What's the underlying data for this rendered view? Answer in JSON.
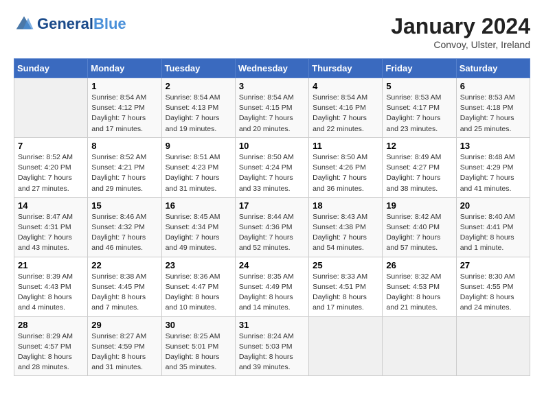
{
  "header": {
    "logo_text_general": "General",
    "logo_text_blue": "Blue",
    "title": "January 2024",
    "subtitle": "Convoy, Ulster, Ireland"
  },
  "days_of_week": [
    "Sunday",
    "Monday",
    "Tuesday",
    "Wednesday",
    "Thursday",
    "Friday",
    "Saturday"
  ],
  "weeks": [
    [
      {
        "num": "",
        "sunrise": "",
        "sunset": "",
        "daylight": ""
      },
      {
        "num": "1",
        "sunrise": "8:54 AM",
        "sunset": "4:12 PM",
        "daylight": "7 hours and 17 minutes."
      },
      {
        "num": "2",
        "sunrise": "8:54 AM",
        "sunset": "4:13 PM",
        "daylight": "7 hours and 19 minutes."
      },
      {
        "num": "3",
        "sunrise": "8:54 AM",
        "sunset": "4:15 PM",
        "daylight": "7 hours and 20 minutes."
      },
      {
        "num": "4",
        "sunrise": "8:54 AM",
        "sunset": "4:16 PM",
        "daylight": "7 hours and 22 minutes."
      },
      {
        "num": "5",
        "sunrise": "8:53 AM",
        "sunset": "4:17 PM",
        "daylight": "7 hours and 23 minutes."
      },
      {
        "num": "6",
        "sunrise": "8:53 AM",
        "sunset": "4:18 PM",
        "daylight": "7 hours and 25 minutes."
      }
    ],
    [
      {
        "num": "7",
        "sunrise": "8:52 AM",
        "sunset": "4:20 PM",
        "daylight": "7 hours and 27 minutes."
      },
      {
        "num": "8",
        "sunrise": "8:52 AM",
        "sunset": "4:21 PM",
        "daylight": "7 hours and 29 minutes."
      },
      {
        "num": "9",
        "sunrise": "8:51 AM",
        "sunset": "4:23 PM",
        "daylight": "7 hours and 31 minutes."
      },
      {
        "num": "10",
        "sunrise": "8:50 AM",
        "sunset": "4:24 PM",
        "daylight": "7 hours and 33 minutes."
      },
      {
        "num": "11",
        "sunrise": "8:50 AM",
        "sunset": "4:26 PM",
        "daylight": "7 hours and 36 minutes."
      },
      {
        "num": "12",
        "sunrise": "8:49 AM",
        "sunset": "4:27 PM",
        "daylight": "7 hours and 38 minutes."
      },
      {
        "num": "13",
        "sunrise": "8:48 AM",
        "sunset": "4:29 PM",
        "daylight": "7 hours and 41 minutes."
      }
    ],
    [
      {
        "num": "14",
        "sunrise": "8:47 AM",
        "sunset": "4:31 PM",
        "daylight": "7 hours and 43 minutes."
      },
      {
        "num": "15",
        "sunrise": "8:46 AM",
        "sunset": "4:32 PM",
        "daylight": "7 hours and 46 minutes."
      },
      {
        "num": "16",
        "sunrise": "8:45 AM",
        "sunset": "4:34 PM",
        "daylight": "7 hours and 49 minutes."
      },
      {
        "num": "17",
        "sunrise": "8:44 AM",
        "sunset": "4:36 PM",
        "daylight": "7 hours and 52 minutes."
      },
      {
        "num": "18",
        "sunrise": "8:43 AM",
        "sunset": "4:38 PM",
        "daylight": "7 hours and 54 minutes."
      },
      {
        "num": "19",
        "sunrise": "8:42 AM",
        "sunset": "4:40 PM",
        "daylight": "7 hours and 57 minutes."
      },
      {
        "num": "20",
        "sunrise": "8:40 AM",
        "sunset": "4:41 PM",
        "daylight": "8 hours and 1 minute."
      }
    ],
    [
      {
        "num": "21",
        "sunrise": "8:39 AM",
        "sunset": "4:43 PM",
        "daylight": "8 hours and 4 minutes."
      },
      {
        "num": "22",
        "sunrise": "8:38 AM",
        "sunset": "4:45 PM",
        "daylight": "8 hours and 7 minutes."
      },
      {
        "num": "23",
        "sunrise": "8:36 AM",
        "sunset": "4:47 PM",
        "daylight": "8 hours and 10 minutes."
      },
      {
        "num": "24",
        "sunrise": "8:35 AM",
        "sunset": "4:49 PM",
        "daylight": "8 hours and 14 minutes."
      },
      {
        "num": "25",
        "sunrise": "8:33 AM",
        "sunset": "4:51 PM",
        "daylight": "8 hours and 17 minutes."
      },
      {
        "num": "26",
        "sunrise": "8:32 AM",
        "sunset": "4:53 PM",
        "daylight": "8 hours and 21 minutes."
      },
      {
        "num": "27",
        "sunrise": "8:30 AM",
        "sunset": "4:55 PM",
        "daylight": "8 hours and 24 minutes."
      }
    ],
    [
      {
        "num": "28",
        "sunrise": "8:29 AM",
        "sunset": "4:57 PM",
        "daylight": "8 hours and 28 minutes."
      },
      {
        "num": "29",
        "sunrise": "8:27 AM",
        "sunset": "4:59 PM",
        "daylight": "8 hours and 31 minutes."
      },
      {
        "num": "30",
        "sunrise": "8:25 AM",
        "sunset": "5:01 PM",
        "daylight": "8 hours and 35 minutes."
      },
      {
        "num": "31",
        "sunrise": "8:24 AM",
        "sunset": "5:03 PM",
        "daylight": "8 hours and 39 minutes."
      },
      {
        "num": "",
        "sunrise": "",
        "sunset": "",
        "daylight": ""
      },
      {
        "num": "",
        "sunrise": "",
        "sunset": "",
        "daylight": ""
      },
      {
        "num": "",
        "sunrise": "",
        "sunset": "",
        "daylight": ""
      }
    ]
  ],
  "labels": {
    "sunrise_prefix": "Sunrise: ",
    "sunset_prefix": "Sunset: ",
    "daylight_prefix": "Daylight: "
  }
}
